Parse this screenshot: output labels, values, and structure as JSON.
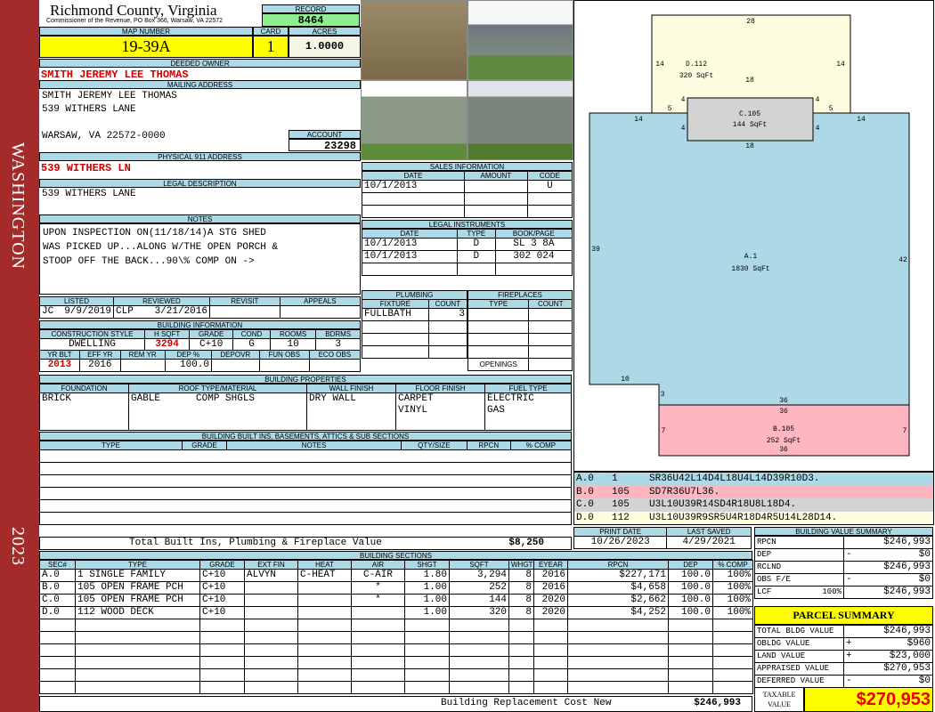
{
  "sidebar": {
    "district": "WASHINGTON",
    "year": "2023"
  },
  "header": {
    "county": "Richmond County, Virginia",
    "subtitle": "Commissioner of the Revenue, PO Box 366, Warsaw, VA 22572",
    "record_label": "RECORD",
    "record": "8464",
    "map_label": "MAP NUMBER",
    "map_number": "19-39A",
    "card_label": "CARD",
    "card": "1",
    "acres_label": "ACRES",
    "acres": "1.0000"
  },
  "owner": {
    "label": "DEEDED OWNER",
    "name": "SMITH JEREMY LEE THOMAS",
    "mailing_label": "MAILING ADDRESS",
    "mail_line1": "SMITH JEREMY LEE THOMAS",
    "mail_line2": "539 WITHERS LANE",
    "mail_line3": "WARSAW, VA 22572-0000",
    "account_label": "ACCOUNT",
    "account": "23298",
    "physical_label": "PHYSICAL 911 ADDRESS",
    "physical": "539 WITHERS LN",
    "legal_label": "LEGAL DESCRIPTION",
    "legal": "539 WITHERS LANE",
    "notes_label": "NOTES",
    "notes": [
      "UPON INSPECTION ON(11/18/14)A STG SHED",
      "WAS PICKED UP...ALONG W/THE OPEN PORCH &",
      "STOOP OFF THE BACK...90\\% COMP ON ->"
    ]
  },
  "sales": {
    "title": "SALES INFORMATION",
    "cols": [
      "DATE",
      "AMOUNT",
      "CODE"
    ],
    "rows": [
      [
        "10/1/2013",
        "",
        "U"
      ]
    ]
  },
  "legal_instruments": {
    "title": "LEGAL INSTRUMENTS",
    "cols": [
      "DATE",
      "TYPE",
      "BOOK/PAGE"
    ],
    "rows": [
      [
        "10/1/2013",
        "D",
        "SL 3 8A"
      ],
      [
        "10/1/2013",
        "D",
        "302 024"
      ]
    ]
  },
  "plumbing": {
    "title": "PLUMBING",
    "cols": [
      "FIXTURE",
      "COUNT"
    ],
    "rows": [
      [
        "FULLBATH",
        "3"
      ]
    ]
  },
  "fireplaces": {
    "title": "FIREPLACES",
    "cols": [
      "TYPE",
      "COUNT"
    ],
    "openings_label": "OPENINGS"
  },
  "listing": {
    "cols": [
      "LISTED",
      "REVIEWED",
      "REVISIT",
      "APPEALS"
    ],
    "listed_by": "JC",
    "listed_date": "9/9/2019",
    "reviewed_by": "CLP",
    "reviewed_date": "3/21/2016"
  },
  "building_info": {
    "title": "BUILDING INFORMATION",
    "cols1": [
      "CONSTRUCTION STYLE",
      "H SQFT",
      "GRADE",
      "COND",
      "ROOMS",
      "BDRMS"
    ],
    "style": "DWELLING",
    "hsqft": "3294",
    "grade": "C+10",
    "cond": "G",
    "rooms": "10",
    "bdrms": "3",
    "cols2": [
      "YR BLT",
      "EFF YR",
      "REM YR",
      "DEP %",
      "DEPOVR",
      "FUN OBS",
      "ECO OBS"
    ],
    "yr_blt": "2013",
    "eff_yr": "2016",
    "dep": "100.0"
  },
  "properties": {
    "title": "BUILDING PROPERTIES",
    "cols": [
      "FOUNDATION",
      "ROOF TYPE/MATERIAL",
      "WALL FINISH",
      "FLOOR FINISH",
      "FUEL TYPE"
    ],
    "foundation": "BRICK",
    "roof_type": "GABLE",
    "roof_material": "COMP SHGLS",
    "wall": "DRY WALL",
    "floor1": "CARPET",
    "floor2": "VINYL",
    "fuel1": "ELECTRIC",
    "fuel2": "GAS"
  },
  "built_ins": {
    "title": "BUILDING BUILT INS, BASEMENTS, ATTICS & SUB SECTIONS",
    "cols": [
      "TYPE",
      "GRADE",
      "NOTES",
      "QTY/SIZE",
      "RPCN",
      "% COMP"
    ],
    "total_label": "Total Built Ins, Plumbing & Fireplace Value",
    "total": "$8,250"
  },
  "sections": {
    "title": "BUILDING SECTIONS",
    "cols": [
      "SEC#",
      "TYPE",
      "GRADE",
      "EXT FIN",
      "HEAT",
      "AIR",
      "SHGT",
      "SQFT",
      "WHGT",
      "EYEAR",
      "RPCN",
      "DEP",
      "% COMP"
    ],
    "rows": [
      [
        "A.0",
        "1 SINGLE FAMILY",
        "C+10",
        "ALVYN",
        "C-HEAT",
        "C-AIR",
        "1.80",
        "3,294",
        "8",
        "2016",
        "$227,171",
        "100.0",
        "100%"
      ],
      [
        "B.0",
        "105 OPEN FRAME PCH",
        "C+10",
        "",
        "",
        "*",
        "1.00",
        "252",
        "8",
        "2016",
        "$4,658",
        "100.0",
        "100%"
      ],
      [
        "C.0",
        "105 OPEN FRAME PCH",
        "C+10",
        "",
        "",
        "*",
        "1.00",
        "144",
        "8",
        "2020",
        "$2,662",
        "100.0",
        "100%"
      ],
      [
        "D.0",
        "112 WOOD DECK",
        "C+10",
        "",
        "",
        "",
        "1.00",
        "320",
        "8",
        "2020",
        "$4,252",
        "100.0",
        "100%"
      ]
    ],
    "replacement_label": "Building Replacement Cost New",
    "replacement": "$246,993"
  },
  "sketch": {
    "labels": {
      "a_name": "A.1",
      "a_area": "1830 SqFt",
      "b_name": "B.105",
      "b_area": "252 SqFt",
      "c_name": "C.105",
      "c_area": "144 SqFt",
      "d_name": "D.112",
      "d_area": "320 SqFt"
    },
    "dims": {
      "d_top": "28",
      "d_left": "14",
      "d_right": "14",
      "d_inner": "18",
      "c_left": "4",
      "c_right": "4",
      "c_l5": "5",
      "c_r5": "5",
      "c_bottom": "18",
      "c_l4b": "4",
      "c_r4b": "4",
      "a_l14": "14",
      "a_r14": "14",
      "a_left": "39",
      "a_right": "42",
      "a_10": "10",
      "a_3": "3",
      "b_top": "36",
      "b_top2": "36",
      "b_left": "7",
      "b_right": "7",
      "b_bottom": "36"
    },
    "legend": [
      {
        "sec": "A.0",
        "code": "1",
        "vec": "SR36U42L14D4L18U4L14D39R10D3.",
        "color": "#add8e6"
      },
      {
        "sec": "B.0",
        "code": "105",
        "vec": "SD7R36U7L36.",
        "color": "#ffb6c1"
      },
      {
        "sec": "C.0",
        "code": "105",
        "vec": "U3L10U39R14SD4R18U8L18D4.",
        "color": "#d3d3d3"
      },
      {
        "sec": "D.0",
        "code": "112",
        "vec": "U3L10U39R9SR5U4R18D4R5U14L28D14.",
        "color": "#fffde0"
      }
    ]
  },
  "dates": {
    "print_label": "PRINT DATE",
    "print": "10/26/2023",
    "saved_label": "LAST SAVED",
    "saved": "4/29/2021"
  },
  "value_summary": {
    "title": "BUILDING VALUE SUMMARY",
    "rows": [
      {
        "label": "RPCN",
        "sign": "",
        "value": "$246,993"
      },
      {
        "label": "DEP",
        "sign": "-",
        "value": "$0"
      },
      {
        "label": "RCLND",
        "sign": "",
        "value": "$246,993"
      },
      {
        "label": "OBS F/E",
        "sign": "-",
        "value": "$0"
      },
      {
        "label": "LCF",
        "pct": "100%",
        "sign": "",
        "value": "$246,993"
      }
    ]
  },
  "parcel": {
    "title": "PARCEL SUMMARY",
    "rows": [
      {
        "label": "TOTAL BLDG VALUE",
        "sign": "",
        "value": "$246,993"
      },
      {
        "label": "OBLDG VALUE",
        "sign": "+",
        "value": "$960"
      },
      {
        "label": "LAND VALUE",
        "sign": "+",
        "value": "$23,000"
      },
      {
        "label": "APPRAISED VALUE",
        "sign": "",
        "value": "$270,953"
      },
      {
        "label": "DEFERRED VALUE",
        "sign": "-",
        "value": "$0"
      }
    ],
    "taxable_label": "TAXABLE VALUE",
    "taxable": "$270,953"
  }
}
